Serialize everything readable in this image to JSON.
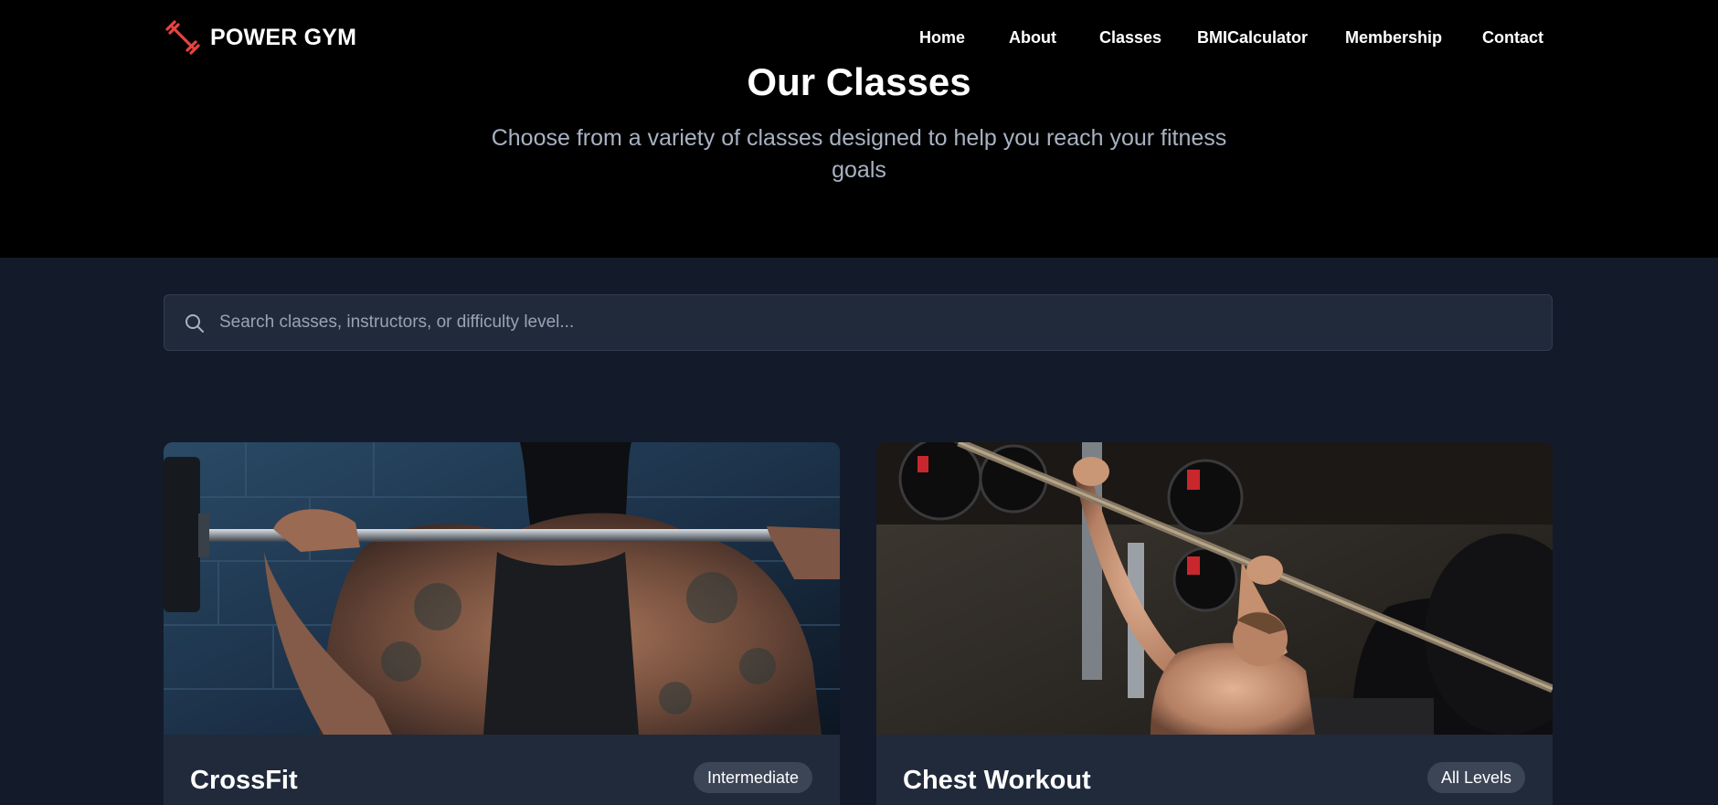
{
  "brand": {
    "name": "POWER GYM",
    "icon": "dumbbell-icon",
    "accent_color": "#e8433f"
  },
  "nav": {
    "items": [
      {
        "label": "Home"
      },
      {
        "label": "About"
      },
      {
        "label": "Classes"
      },
      {
        "label": "BMICalculator"
      },
      {
        "label": "Membership"
      },
      {
        "label": "Contact"
      }
    ]
  },
  "hero": {
    "title": "Our Classes",
    "subtitle": "Choose from a variety of classes designed to help you reach your fitness goals"
  },
  "search": {
    "placeholder": "Search classes, instructors, or difficulty level...",
    "value": "",
    "icon": "search-icon"
  },
  "classes": [
    {
      "title": "CrossFit",
      "level": "Intermediate",
      "image": "barbell-back-squat-photo"
    },
    {
      "title": "Chest Workout",
      "level": "All Levels",
      "image": "bench-press-photo"
    }
  ],
  "colors": {
    "hero_background": "#000000",
    "page_background": "#131b2b",
    "card_background": "#212a3b",
    "badge_background": "#3b4556",
    "subtitle_text": "#a8b2c2"
  }
}
